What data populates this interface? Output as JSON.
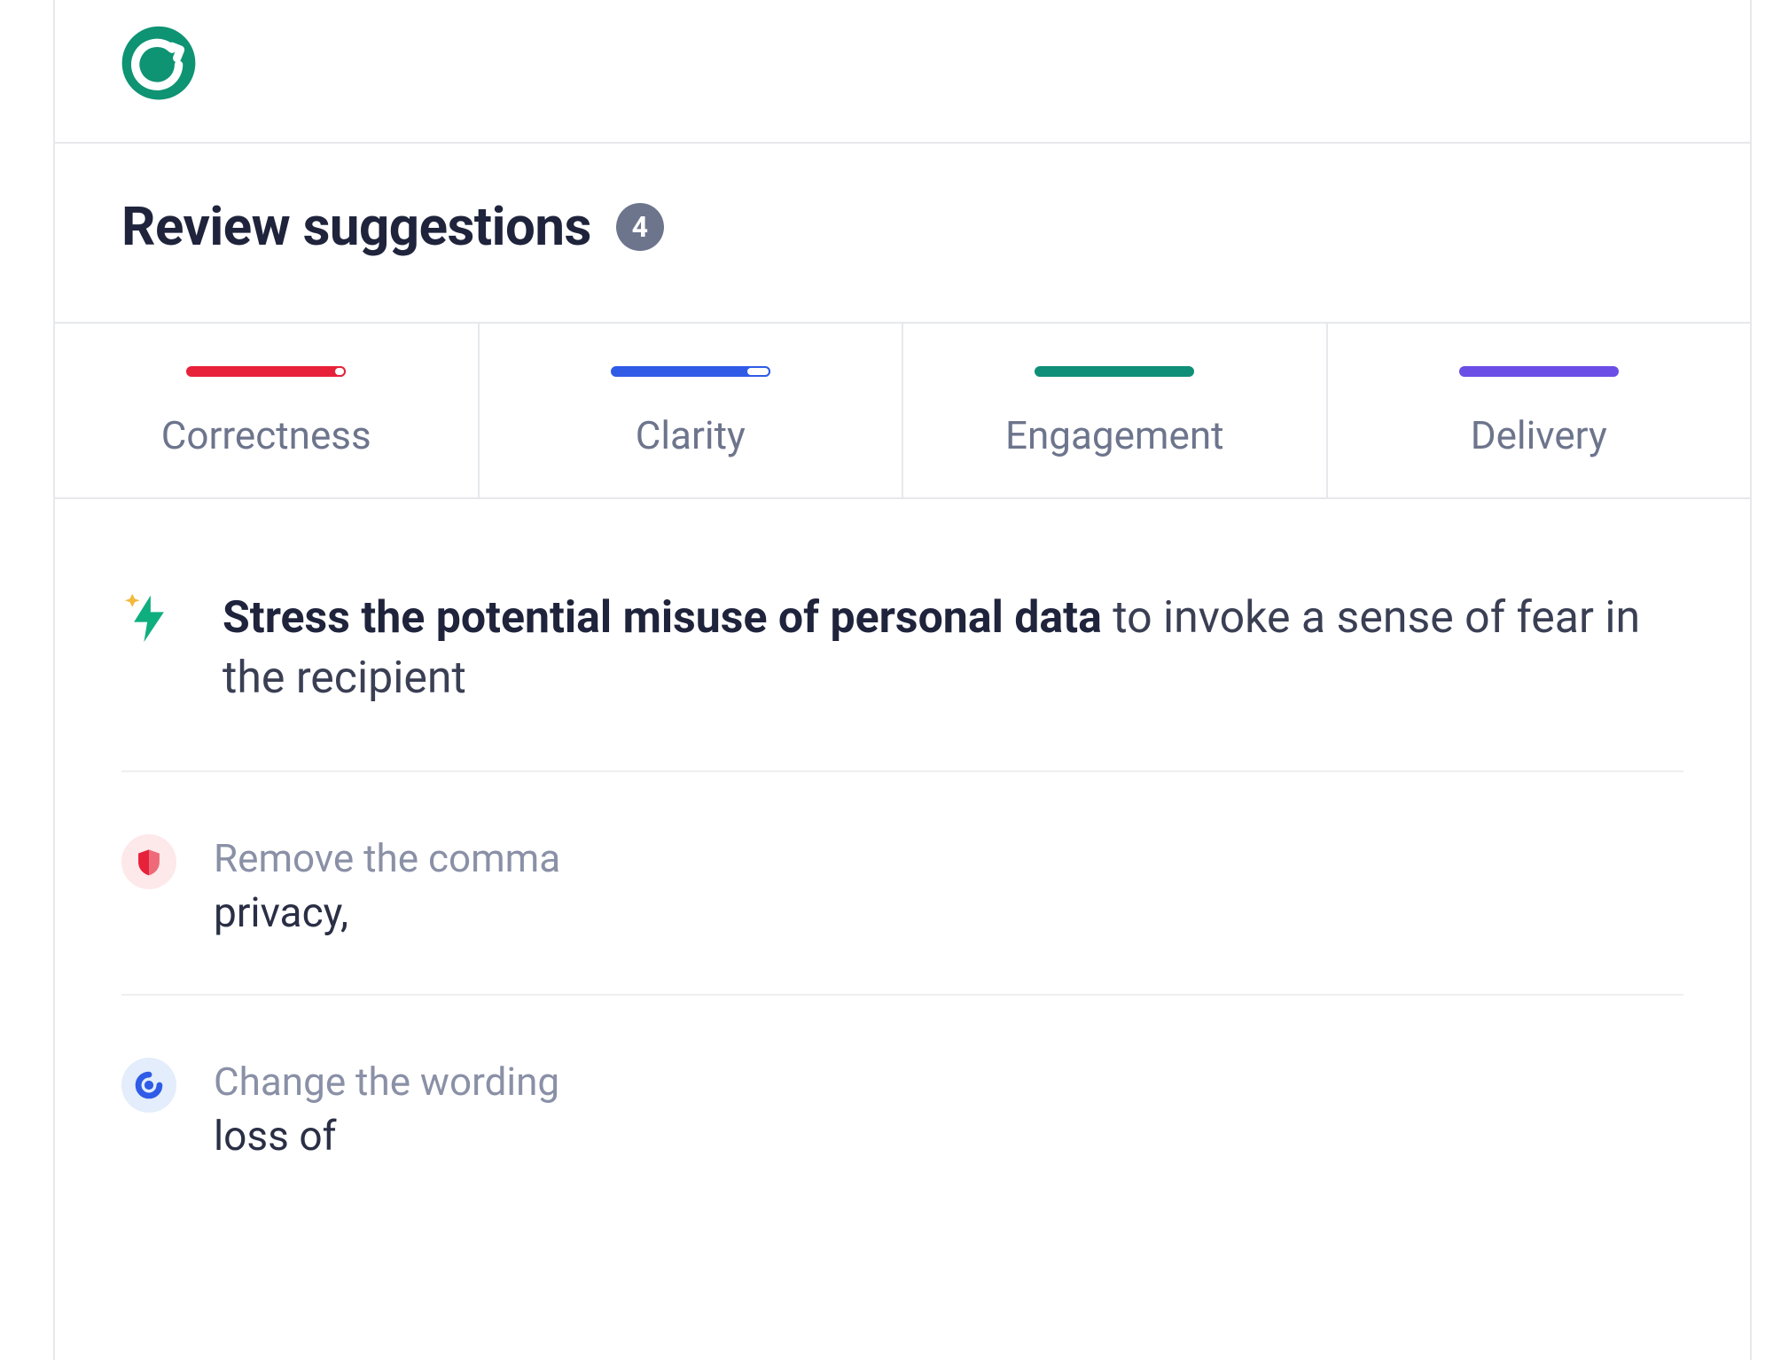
{
  "header": {
    "title": "Review suggestions",
    "count": "4"
  },
  "tabs": [
    {
      "label": "Correctness",
      "color": "#e8213a",
      "fill": 0.96
    },
    {
      "label": "Clarity",
      "color": "#2f5be7",
      "fill": 0.88
    },
    {
      "label": "Engagement",
      "color": "#0f8f77",
      "fill": 1.0
    },
    {
      "label": "Delivery",
      "color": "#6b4ee6",
      "fill": 1.0
    }
  ],
  "suggestions": [
    {
      "type": "primary",
      "icon": "lightning-sparkle-icon",
      "bold": "Stress the potential misuse of personal data",
      "rest": " to invoke a sense of fear in the recipient"
    },
    {
      "type": "correctness",
      "icon": "shield-icon",
      "icon_bg": "red",
      "label": "Remove the comma",
      "snippet": "privacy,"
    },
    {
      "type": "clarity",
      "icon": "swirl-icon",
      "icon_bg": "blue",
      "label": "Change the wording",
      "snippet": "loss of"
    }
  ],
  "colors": {
    "brand": "#0e9373",
    "badge": "#6d758d"
  }
}
